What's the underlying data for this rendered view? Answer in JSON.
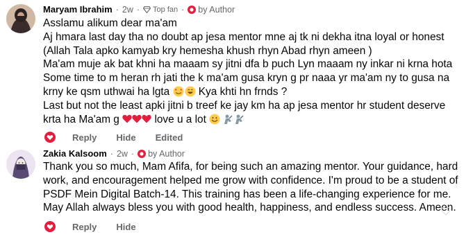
{
  "comments": [
    {
      "author": "Maryam Ibrahim",
      "time": "2w",
      "top_fan": "Top fan",
      "by_author": "by Author",
      "lines": [
        "Asslamu alikum dear ma'am",
        "Aj hmara last day tha no doubt ap jesa mentor mne aj tk ni dekha itna loyal or honest",
        "(Allah Tala apko kamyab kry hemesha khush rhyn Abad rhyn ameen )",
        "Ma'am muje ak bat khni ha maaam sy jitni dfa b puch Lyn maaam ny inkar ni krna hota",
        "Some time to m heran rh jati the k ma'am gusa kryn g pr naaa yr ma'am ny to gusa na",
        "krny ke qsm uthwai ha lgta",
        "Last but not the least apki jitni b treef ke jay km ha ap jesa mentor hr student deserve",
        "krta ha Ma'am g"
      ],
      "line6_suffix": "Kya khti hn frnds ?",
      "line8_suffix": "love u a lot",
      "actions": {
        "reply": "Reply",
        "hide": "Hide",
        "edited": "Edited"
      }
    },
    {
      "author": "Zakia Kalsoom",
      "time": "2w",
      "by_author": "by Author",
      "lines": [
        "Thank you so much, Mam Afifa, for being such an amazing mentor. Your guidance, hard",
        "work, and encouragement helped me grow with confidence. I'm proud to be a student of",
        "PSDF Mein Digital Batch-14. This training has been a life-changing experience for me.",
        "May Allah always bless you with good health, happiness, and endless success. Ameen."
      ],
      "actions": {
        "reply": "Reply",
        "hide": "Hide"
      }
    }
  ],
  "colors": {
    "author_badge": "#e41e3f",
    "meta_text": "#65676b",
    "body_text": "#050505",
    "heart": "#e41e3f"
  }
}
